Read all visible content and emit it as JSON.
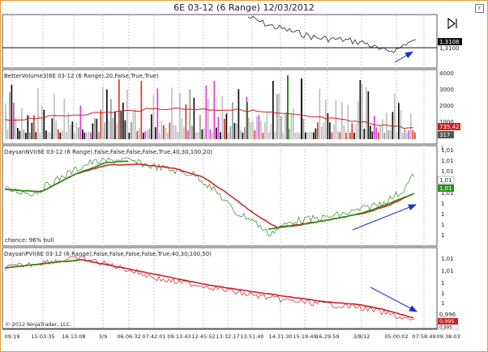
{
  "window": {
    "title": "6E 03-12 (6 Range)  12/03/2012",
    "restore_glyph": "r"
  },
  "colors": {
    "ma_green": "#2c8c1e",
    "ma_red": "#cc1f1f",
    "arrow_blue": "#1f2bd6",
    "window_border": "#e39b3c",
    "price_line": "#222222"
  },
  "panels": {
    "price": {
      "ticks": [
        "1,3100"
      ],
      "last_price_tag": "1,3108",
      "play_icon": "next-bar-icon"
    },
    "volume": {
      "label": "BetterVolume3(6E 03-12 (6 Range),20,False,True,True)",
      "ticks": [
        "4000",
        "3000",
        "2000",
        "1000"
      ],
      "avg_tag": "735,42",
      "last_tag": "317"
    },
    "nvi": {
      "label": "DaysanNVI(6E 03-12 (6 Range),False,False,False,False,True,40,30,100,20)",
      "ticks": [
        "1,01",
        "1,01",
        "1,01",
        "1,01",
        "1",
        "1",
        "1",
        "1",
        "1"
      ],
      "tags": [
        "1,01",
        "1,01"
      ],
      "note": "chance: 96% bull"
    },
    "pvi": {
      "label": "DaysanPVI(6E 03-12 (6 Range),False,False,False,False,True,40,30,100,50)",
      "ticks": [
        "1,01",
        "1,01",
        "1",
        "1",
        "1",
        "0,996",
        "0,996"
      ],
      "tags": [
        "0,995",
        "0,995"
      ],
      "copyright": "© 2012 NinjaTrader, LLC"
    }
  },
  "time_axis": [
    "09:19",
    "15:03:35",
    "16:13:08",
    "3/9",
    "06:06:32",
    "07:42:01",
    "09:13:43",
    "12:45:52",
    "13:32:17",
    "13:51:40",
    "14:31:30",
    "15:19:49",
    "16:29:59",
    "3/8/12",
    "05:00:02",
    "07:58:49",
    "09:38:03"
  ]
}
